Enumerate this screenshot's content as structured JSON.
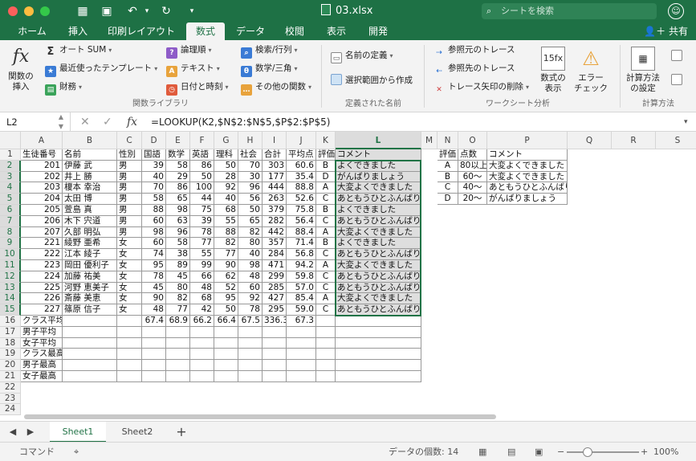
{
  "title": {
    "filename": "03.xlsx",
    "search_placeholder": "シートを検索"
  },
  "tabs": [
    "ホーム",
    "挿入",
    "印刷レイアウト",
    "数式",
    "データ",
    "校閲",
    "表示",
    "開発"
  ],
  "share_label": "共有",
  "ribbon": {
    "fx_label1": "関数の",
    "fx_label2": "挿入",
    "autosum": "オート SUM",
    "recent": "最近使ったテンプレート",
    "finance": "財務",
    "logical": "論理順",
    "text": "テキスト",
    "datetime": "日付と時刻",
    "lookup": "検索/行列",
    "math": "数学/三角",
    "other": "その他の関数",
    "group_lib": "関数ライブラリ",
    "name_def": "名前の定義",
    "create_sel": "選択範囲から作成",
    "group_names": "定義された名前",
    "trace_prec": "参照元のトレース",
    "trace_dep": "参照先のトレース",
    "remove_arrows": "トレース矢印の削除",
    "show_formulas1": "数式の",
    "show_formulas2": "表示",
    "error_check1": "エラー",
    "error_check2": "チェック",
    "group_audit": "ワークシート分析",
    "calc_opts1": "計算方法",
    "calc_opts2": "の設定",
    "group_calc": "計算方法"
  },
  "formula_bar": {
    "name_box": "L2",
    "formula": "=LOOKUP(K2,$N$2:$N$5,$P$2:$P$5)"
  },
  "columns": [
    "A",
    "B",
    "C",
    "D",
    "E",
    "F",
    "G",
    "H",
    "I",
    "J",
    "K",
    "L",
    "M",
    "N",
    "O",
    "P",
    "Q",
    "R",
    "S"
  ],
  "rows": [
    "1",
    "2",
    "3",
    "4",
    "5",
    "6",
    "7",
    "8",
    "9",
    "10",
    "11",
    "12",
    "13",
    "14",
    "15",
    "16",
    "17",
    "18",
    "19",
    "20",
    "21",
    "22",
    "23",
    "24"
  ],
  "header_row": [
    "生徒番号",
    "名前",
    "性別",
    "国語",
    "数学",
    "英語",
    "理科",
    "社会",
    "合計",
    "平均点",
    "評価",
    "コメント"
  ],
  "students": [
    [
      "201",
      "伊藤 武",
      "男",
      "39",
      "58",
      "86",
      "50",
      "70",
      "303",
      "60.6",
      "B",
      "よくできました"
    ],
    [
      "202",
      "井上 勝",
      "男",
      "40",
      "29",
      "50",
      "28",
      "30",
      "177",
      "35.4",
      "D",
      "がんばりましょう"
    ],
    [
      "203",
      "榎本 幸治",
      "男",
      "70",
      "86",
      "100",
      "92",
      "96",
      "444",
      "88.8",
      "A",
      "大変よくできました"
    ],
    [
      "204",
      "太田 博",
      "男",
      "58",
      "65",
      "44",
      "40",
      "56",
      "263",
      "52.6",
      "C",
      "あともうひとふんばり"
    ],
    [
      "205",
      "萱島 真",
      "男",
      "88",
      "98",
      "75",
      "68",
      "50",
      "379",
      "75.8",
      "B",
      "よくできました"
    ],
    [
      "206",
      "木下 宍道",
      "男",
      "60",
      "63",
      "39",
      "55",
      "65",
      "282",
      "56.4",
      "C",
      "あともうひとふんばり"
    ],
    [
      "207",
      "久部 明弘",
      "男",
      "98",
      "96",
      "78",
      "88",
      "82",
      "442",
      "88.4",
      "A",
      "大変よくできました"
    ],
    [
      "221",
      "綾野 亜希",
      "女",
      "60",
      "58",
      "77",
      "82",
      "80",
      "357",
      "71.4",
      "B",
      "よくできました"
    ],
    [
      "222",
      "江本 綾子",
      "女",
      "74",
      "38",
      "55",
      "77",
      "40",
      "284",
      "56.8",
      "C",
      "あともうひとふんばり"
    ],
    [
      "223",
      "岡田 優利子",
      "女",
      "95",
      "89",
      "99",
      "90",
      "98",
      "471",
      "94.2",
      "A",
      "大変よくできました"
    ],
    [
      "224",
      "加藤 祐美",
      "女",
      "78",
      "45",
      "66",
      "62",
      "48",
      "299",
      "59.8",
      "C",
      "あともうひとふんばり"
    ],
    [
      "225",
      "河野 恵美子",
      "女",
      "45",
      "80",
      "48",
      "52",
      "60",
      "285",
      "57.0",
      "C",
      "あともうひとふんばり"
    ],
    [
      "226",
      "斎藤 美恵",
      "女",
      "90",
      "82",
      "68",
      "95",
      "92",
      "427",
      "85.4",
      "A",
      "大変よくできました"
    ],
    [
      "227",
      "篠原 信子",
      "女",
      "48",
      "77",
      "42",
      "50",
      "78",
      "295",
      "59.0",
      "C",
      "あともうひとふんばり"
    ]
  ],
  "class_avg": {
    "label": "クラス平均",
    "values": [
      "67.4",
      "68.9",
      "66.2",
      "66.4",
      "67.5",
      "336.3",
      "67.3"
    ]
  },
  "summary_labels": [
    "男子平均",
    "女子平均",
    "クラス最高",
    "男子最高",
    "女子最高"
  ],
  "lookup_header": [
    "評価",
    "点数",
    "コメント"
  ],
  "lookup_rows": [
    [
      "A",
      "80以上",
      "大変よくできました"
    ],
    [
      "B",
      "60～",
      "大変よくできました"
    ],
    [
      "C",
      "40～",
      "あともうひとふんばり"
    ],
    [
      "D",
      "20～",
      "がんばりましょう"
    ]
  ],
  "sheets": [
    "Sheet1",
    "Sheet2"
  ],
  "status": {
    "mode": "コマンド",
    "count": "データの個数: 14",
    "zoom": "100%"
  }
}
